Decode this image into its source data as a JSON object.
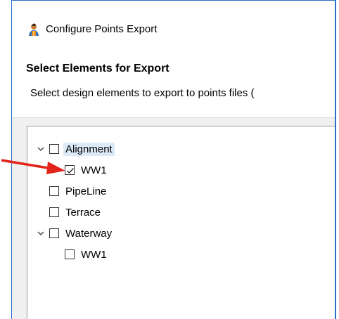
{
  "window": {
    "title": "Configure Points Export",
    "app_icon": "person-icon"
  },
  "header": {
    "title": "Select Elements for Export",
    "description": "Select design elements to export to points files ("
  },
  "tree": {
    "items": [
      {
        "label": "Alignment",
        "expanded": true,
        "checked": false,
        "selected": true
      },
      {
        "label": "WW1",
        "checked": true,
        "parent": "Alignment"
      },
      {
        "label": "PipeLine",
        "checked": false
      },
      {
        "label": "Terrace",
        "checked": false
      },
      {
        "label": "Waterway",
        "expanded": true,
        "checked": false
      },
      {
        "label": "WW1",
        "checked": false,
        "parent": "Waterway"
      }
    ]
  },
  "annotation": {
    "arrow_color": "#e3241b",
    "arrow_target": "WW1 checkbox"
  },
  "colors": {
    "window_border": "#2b6fc8",
    "selection": "#dce9f8"
  }
}
